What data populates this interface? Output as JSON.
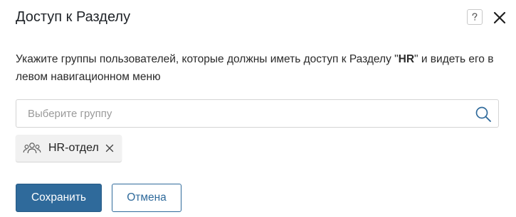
{
  "dialog": {
    "title": "Доступ к Разделу",
    "help_icon": "question-icon",
    "close_icon": "close-icon",
    "description_before": "Укажите группы пользователей, которые должны иметь доступ к Разделу \"",
    "description_bold": "HR",
    "description_after": "\" и видеть его в левом навигационном меню"
  },
  "search": {
    "placeholder": "Выберите группу",
    "value": "",
    "icon": "search-icon"
  },
  "selected_groups": [
    {
      "label": "HR-отдел",
      "icon": "users-group-icon",
      "remove_icon": "close-icon"
    }
  ],
  "actions": {
    "save_label": "Сохранить",
    "cancel_label": "Отмена"
  },
  "colors": {
    "primary": "#2f6a9b",
    "chip_background": "#f1f1f1",
    "border": "#d4d4d4"
  }
}
